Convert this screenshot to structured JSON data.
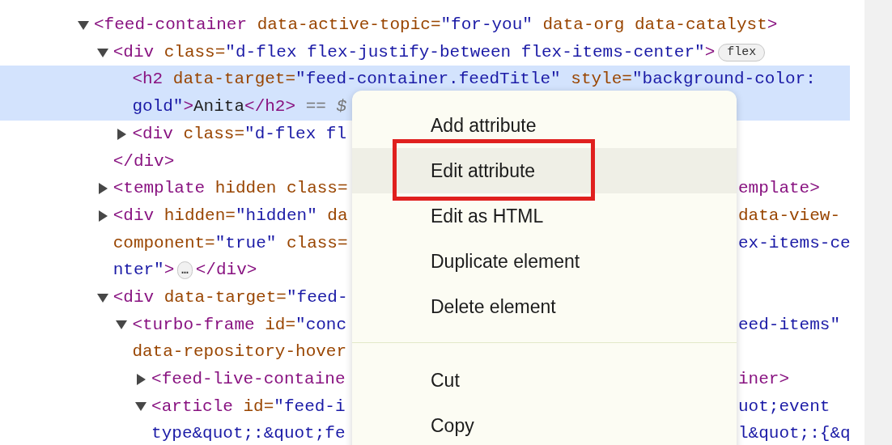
{
  "tree": [
    {
      "selected": false,
      "expanded": true,
      "lines": [
        {
          "left": [
            {
              "kind": "tag",
              "t": "<feed-container "
            },
            {
              "kind": "attr",
              "t": "data-active-topic="
            },
            {
              "kind": "value",
              "t": "\"for-you\""
            },
            {
              "kind": "attr",
              "t": " data-org data-catalyst"
            },
            {
              "kind": "tag",
              "t": ">"
            }
          ]
        }
      ],
      "children": [
        {
          "selected": false,
          "expanded": true,
          "lines": [
            {
              "left": [
                {
                  "kind": "tag",
                  "t": "<div "
                },
                {
                  "kind": "attr",
                  "t": "class="
                },
                {
                  "kind": "value",
                  "t": "\"d-flex flex-justify-between flex-items-center\""
                },
                {
                  "kind": "tag",
                  "t": ">"
                },
                {
                  "kind": "pill",
                  "t": "flex"
                }
              ]
            }
          ],
          "children": [
            {
              "selected": true,
              "lines": [
                {
                  "left": [
                    {
                      "kind": "tag",
                      "t": "<h2 "
                    },
                    {
                      "kind": "attr",
                      "t": "data-target="
                    },
                    {
                      "kind": "value",
                      "t": "\"feed-container.feedTitle\""
                    },
                    {
                      "kind": "attr",
                      "t": " style="
                    },
                    {
                      "kind": "value",
                      "t": "\"background-color:"
                    }
                  ]
                },
                {
                  "left": [
                    {
                      "kind": "value",
                      "t": "gold\""
                    },
                    {
                      "kind": "tag",
                      "t": ">"
                    },
                    {
                      "kind": "text",
                      "t": "Anita"
                    },
                    {
                      "kind": "tag",
                      "t": "</h2>"
                    },
                    {
                      "kind": "hint",
                      "t": " == $"
                    }
                  ]
                }
              ]
            },
            {
              "selected": false,
              "expanded": false,
              "lines": [
                {
                  "left": [
                    {
                      "kind": "tag",
                      "t": "<div "
                    },
                    {
                      "kind": "attr",
                      "t": "class="
                    },
                    {
                      "kind": "value",
                      "t": "\"d-flex fl"
                    }
                  ]
                }
              ]
            }
          ]
        },
        {
          "selected": false,
          "lines": [
            {
              "left": [
                {
                  "kind": "tag",
                  "t": "</div>"
                }
              ]
            }
          ]
        },
        {
          "selected": false,
          "expanded": false,
          "lines": [
            {
              "left": [
                {
                  "kind": "tag",
                  "t": "<template "
                },
                {
                  "kind": "attr",
                  "t": "hidden class="
                }
              ],
              "right": [
                {
                  "kind": "tag",
                  "t": "emplate>"
                }
              ]
            }
          ]
        },
        {
          "selected": false,
          "expanded": false,
          "lines": [
            {
              "left": [
                {
                  "kind": "tag",
                  "t": "<div "
                },
                {
                  "kind": "attr",
                  "t": "hidden="
                },
                {
                  "kind": "value",
                  "t": "\"hidden\""
                },
                {
                  "kind": "attr",
                  "t": " da"
                }
              ],
              "right": [
                {
                  "kind": "attr",
                  "t": "data-view-"
                }
              ]
            },
            {
              "left": [
                {
                  "kind": "attr",
                  "t": "component="
                },
                {
                  "kind": "value",
                  "t": "\"true\""
                },
                {
                  "kind": "attr",
                  "t": " class="
                }
              ],
              "right": [
                {
                  "kind": "value",
                  "t": "ex-items-ce"
                }
              ]
            },
            {
              "left": [
                {
                  "kind": "value",
                  "t": "nter\""
                },
                {
                  "kind": "tag",
                  "t": ">"
                },
                {
                  "kind": "pill",
                  "t": "…"
                },
                {
                  "kind": "tag",
                  "t": "</div>"
                }
              ]
            }
          ]
        },
        {
          "selected": false,
          "expanded": true,
          "lines": [
            {
              "left": [
                {
                  "kind": "tag",
                  "t": "<div "
                },
                {
                  "kind": "attr",
                  "t": "data-target="
                },
                {
                  "kind": "value",
                  "t": "\"feed-"
                }
              ]
            }
          ],
          "children": [
            {
              "selected": false,
              "expanded": true,
              "lines": [
                {
                  "left": [
                    {
                      "kind": "tag",
                      "t": "<turbo-frame "
                    },
                    {
                      "kind": "attr",
                      "t": "id="
                    },
                    {
                      "kind": "value",
                      "t": "\"conc"
                    }
                  ],
                  "right": [
                    {
                      "kind": "value",
                      "t": "eed-items\""
                    }
                  ]
                },
                {
                  "left": [
                    {
                      "kind": "attr",
                      "t": "data-repository-hover"
                    }
                  ]
                }
              ],
              "children": [
                {
                  "selected": false,
                  "expanded": false,
                  "lines": [
                    {
                      "left": [
                        {
                          "kind": "tag",
                          "t": "<feed-live-containe"
                        }
                      ],
                      "right": [
                        {
                          "kind": "tag",
                          "t": "iner>"
                        }
                      ]
                    }
                  ]
                },
                {
                  "selected": false,
                  "expanded": true,
                  "lines": [
                    {
                      "left": [
                        {
                          "kind": "tag",
                          "t": "<article "
                        },
                        {
                          "kind": "attr",
                          "t": "id="
                        },
                        {
                          "kind": "value",
                          "t": "\"feed-i"
                        }
                      ],
                      "right": [
                        {
                          "kind": "value",
                          "t": "uot;event"
                        }
                      ]
                    },
                    {
                      "left": [
                        {
                          "kind": "value",
                          "t": "type&quot;:&quot;fe"
                        }
                      ],
                      "right": [
                        {
                          "kind": "value",
                          "t": "l&quot;:{&q"
                        }
                      ]
                    }
                  ]
                }
              ]
            }
          ]
        }
      ]
    }
  ],
  "context_menu": {
    "groups": [
      [
        {
          "label": "Add attribute",
          "selected": false,
          "boxed": false
        },
        {
          "label": "Edit attribute",
          "selected": true,
          "boxed": true
        },
        {
          "label": "Edit as HTML",
          "selected": false,
          "boxed": false
        },
        {
          "label": "Duplicate element",
          "selected": false,
          "boxed": false
        },
        {
          "label": "Delete element",
          "selected": false,
          "boxed": false
        }
      ],
      [
        {
          "label": "Cut",
          "selected": false,
          "boxed": false
        },
        {
          "label": "Copy",
          "selected": false,
          "boxed": false
        }
      ]
    ]
  }
}
